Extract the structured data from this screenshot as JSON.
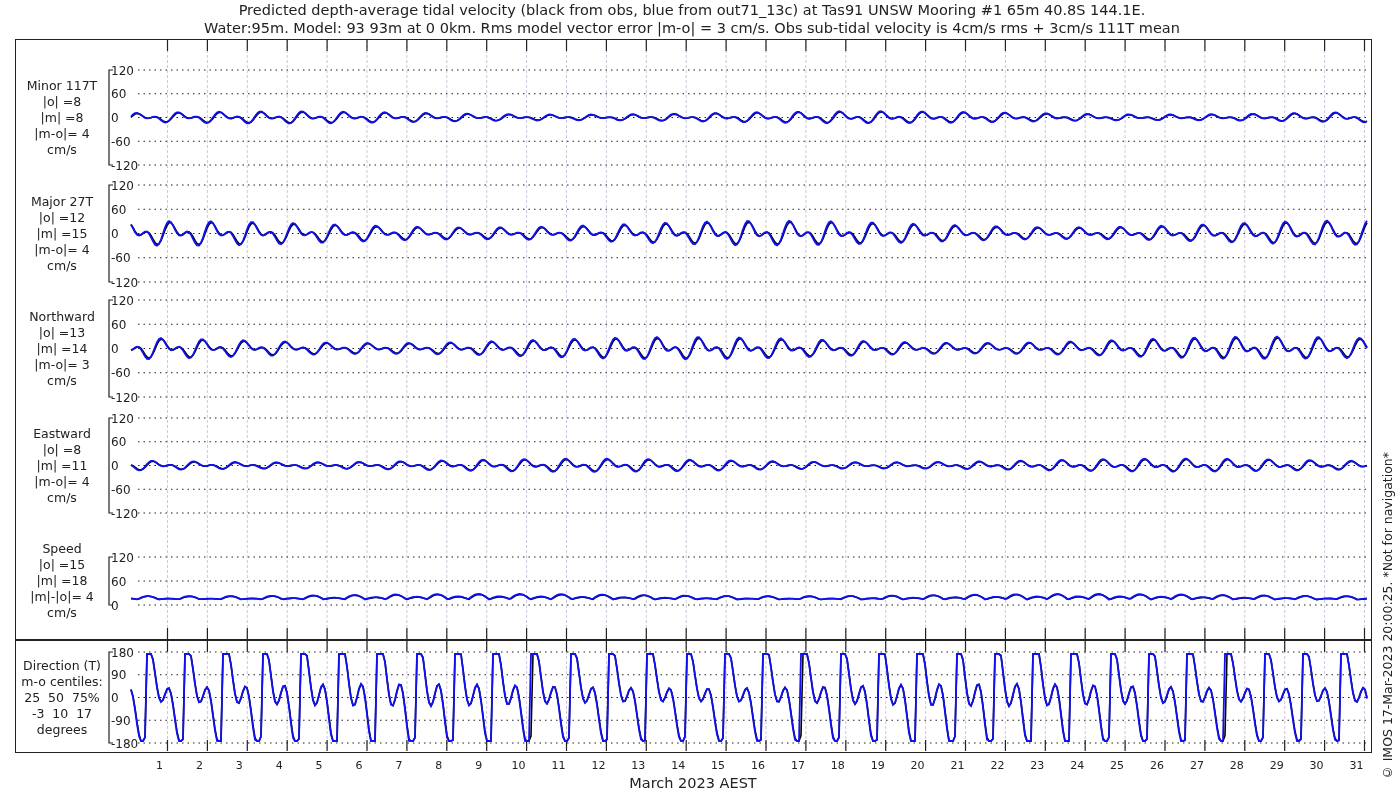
{
  "title": [
    "Predicted depth-average tidal velocity (black from obs, blue from out71_13c) at Tas91 UNSW Mooring #1 65m 40.8S 144.1E.",
    "Water:95m. Model: 93 93m at 0 0km. Rms model vector error |m-o| = 3 cm/s. Obs sub-tidal velocity is 4cm/s rms + 3cm/s 111T mean"
  ],
  "panels": [
    {
      "kind": "signed",
      "label": [
        "Minor 117T",
        "|o| =8",
        "|m| =8",
        "|m-o|= 4",
        "cm/s"
      ],
      "yticks": [
        "120",
        "60",
        "0",
        "-60",
        "-120"
      ]
    },
    {
      "kind": "signed",
      "label": [
        "Major 27T",
        "|o| =12",
        "|m| =15",
        "|m-o|= 4",
        "cm/s"
      ],
      "yticks": [
        "120",
        "60",
        "0",
        "-60",
        "-120"
      ]
    },
    {
      "kind": "signed",
      "label": [
        "Northward",
        "|o| =13",
        "|m| =14",
        "|m-o|= 3",
        "cm/s"
      ],
      "yticks": [
        "120",
        "60",
        "0",
        "-60",
        "-120"
      ]
    },
    {
      "kind": "signed",
      "label": [
        "Eastward",
        "|o| =8",
        "|m| =11",
        "|m-o|= 4",
        "cm/s"
      ],
      "yticks": [
        "120",
        "60",
        "0",
        "-60",
        "-120"
      ]
    },
    {
      "kind": "speed",
      "label": [
        "Speed",
        "|o| =15",
        "|m| =18",
        "|m|-|o|= 4",
        "cm/s"
      ],
      "yticks": [
        "120",
        "60",
        "0"
      ]
    },
    {
      "kind": "direction",
      "label": [
        "Direction (T)",
        "m-o centiles:",
        "25  50  75%",
        "-3  10  17",
        "degrees"
      ],
      "yticks": [
        "180",
        "90",
        "0",
        "-90",
        "-180"
      ]
    }
  ],
  "xticks": [
    "1",
    "2",
    "3",
    "4",
    "5",
    "6",
    "7",
    "8",
    "9",
    "10",
    "11",
    "12",
    "13",
    "14",
    "15",
    "16",
    "17",
    "18",
    "19",
    "20",
    "21",
    "22",
    "23",
    "24",
    "25",
    "26",
    "27",
    "28",
    "29",
    "30",
    "31"
  ],
  "xlabel": "March 2023 AEST",
  "credit": "© IMOS 17-Mar-2023 20:00:25. *Not for navigation*"
}
